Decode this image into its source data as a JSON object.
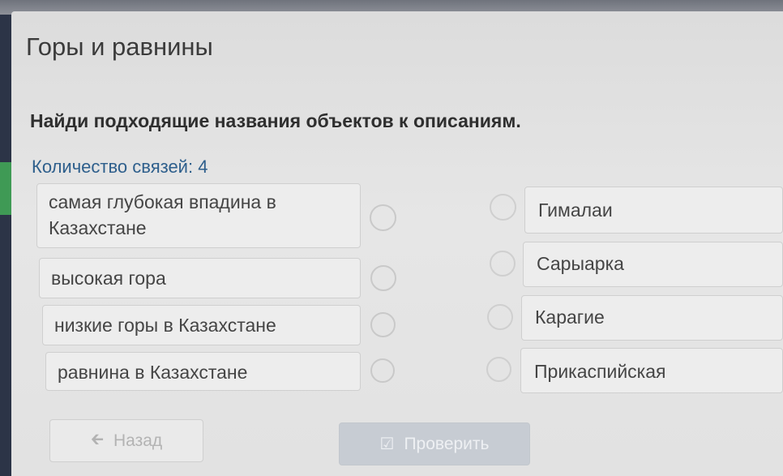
{
  "title": "Горы и равнины",
  "instruction": "Найди подходящие названия объектов к описаниям.",
  "links_count": "Количество связей: 4",
  "left_items": [
    {
      "label": "самая глубокая впадина в Казахстане"
    },
    {
      "label": "высокая гора"
    },
    {
      "label": "низкие горы в Казахстане"
    },
    {
      "label": "равнина в Казахстане"
    }
  ],
  "right_items": [
    {
      "label": "Гималаи"
    },
    {
      "label": "Сарыарка"
    },
    {
      "label": "Карагие"
    },
    {
      "label": "Прикаспийская"
    }
  ],
  "buttons": {
    "back_label": "Назад",
    "back_icon": "arrow-left-icon",
    "check_label": "Проверить",
    "check_icon": "checkbox-check-icon"
  },
  "colors": {
    "accent_text": "#2e5f8c",
    "side_green": "#3f9a55",
    "dark_bg": "#2b3348"
  }
}
